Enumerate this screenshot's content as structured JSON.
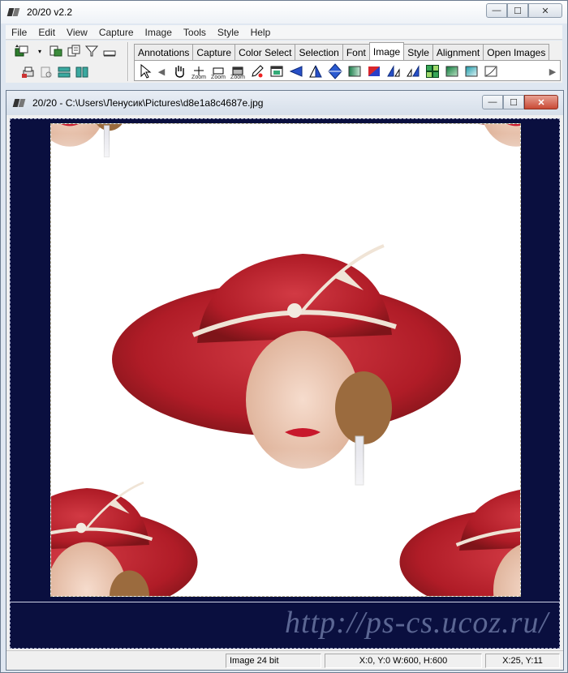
{
  "app": {
    "title": "20/20 v2.2",
    "minimize": "—",
    "maximize": "☐",
    "close": "✕"
  },
  "menu": [
    "File",
    "Edit",
    "View",
    "Capture",
    "Image",
    "Tools",
    "Style",
    "Help"
  ],
  "toolbar": {
    "tabs": [
      "Annotations",
      "Capture",
      "Color Select",
      "Selection",
      "Font",
      "Image",
      "Style",
      "Alignment",
      "Open Images"
    ],
    "active_tab": "Image",
    "zoom_label": "Zoom"
  },
  "document": {
    "title": "20/20 - C:\\Users\\Ленусик\\Pictures\\d8e1a8c4687e.jpg",
    "minimize": "—",
    "maximize": "☐",
    "close": "✕"
  },
  "watermark": "http://ps-cs.ucoz.ru/",
  "status": {
    "image_type": "Image 24 bit",
    "geometry": "X:0, Y:0  W:600, H:600",
    "cursor": "X:25, Y:11"
  },
  "colors": {
    "canvas_bg": "#0a0f3f",
    "hat_red": "#c0202c",
    "watermark": "#5b6693"
  }
}
